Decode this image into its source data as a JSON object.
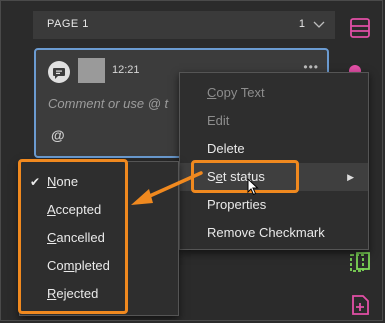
{
  "page_header": {
    "label": "PAGE 1",
    "count": "1"
  },
  "comment": {
    "time": "12:21",
    "more": "•••",
    "placeholder": "Comment or use @ t",
    "at": "@"
  },
  "context_menu": {
    "items": [
      {
        "pre": "",
        "u": "C",
        "post": "opy Text",
        "disabled": true
      },
      {
        "pre": "Edit",
        "u": "",
        "post": "",
        "disabled": true
      },
      {
        "pre": "Delete",
        "u": "",
        "post": "",
        "disabled": false
      },
      {
        "pre": "S",
        "u": "e",
        "post": "t status",
        "disabled": false
      },
      {
        "pre": "Properties",
        "u": "",
        "post": "",
        "disabled": false
      },
      {
        "pre": "Remove Checkmark",
        "u": "",
        "post": "",
        "disabled": false
      }
    ]
  },
  "status_submenu": {
    "items": [
      {
        "u": "N",
        "post": "one",
        "checked": true
      },
      {
        "u": "A",
        "post": "ccepted",
        "checked": false
      },
      {
        "u": "C",
        "post": "ancelled",
        "checked": false
      },
      {
        "pre": "Co",
        "u": "m",
        "post": "pleted",
        "checked": false
      },
      {
        "u": "R",
        "post": "ejected",
        "checked": false
      }
    ]
  },
  "colors": {
    "highlight": "#f0891f",
    "toolbar_pink": "#e24fa6",
    "toolbar_green": "#7ed957",
    "focus_border": "#6b9bd1"
  },
  "icons": [
    "chevron-down-icon",
    "comment-bubble-icon",
    "layout-icon",
    "compare-icon",
    "page-add-icon",
    "check-icon",
    "submenu-arrow-icon",
    "cursor-icon"
  ]
}
